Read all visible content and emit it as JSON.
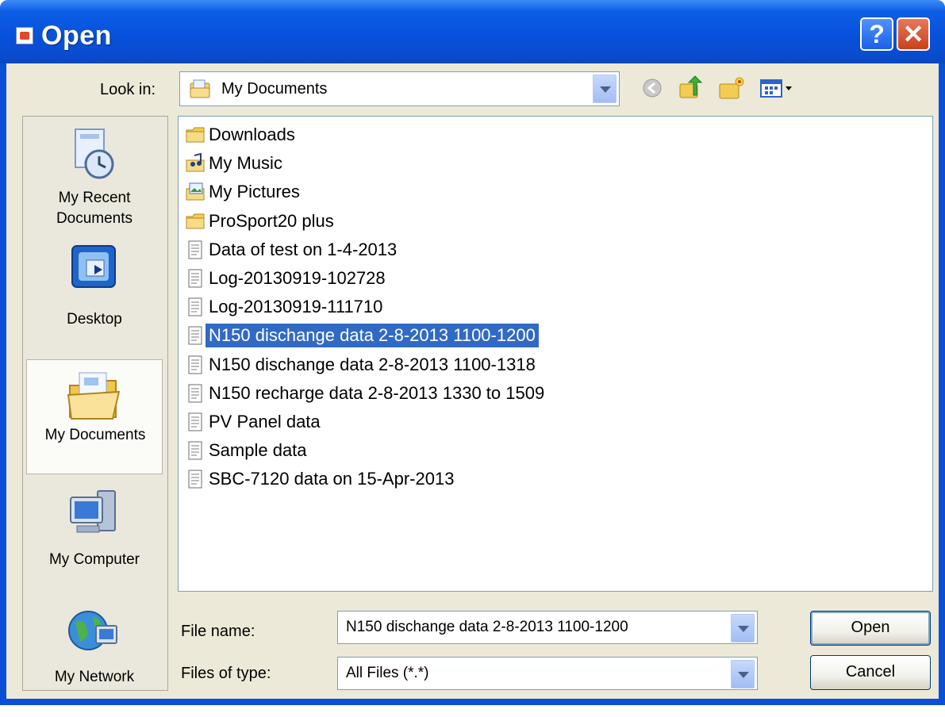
{
  "window": {
    "title": "Open",
    "help_glyph": "?",
    "close_glyph": "✕"
  },
  "toolbar": {
    "look_in_label": "Look in:",
    "look_in_value": "My Documents",
    "icons": [
      "back-icon",
      "up-one-level-icon",
      "create-new-folder-icon",
      "view-menu-icon"
    ]
  },
  "places": {
    "recent": "My Recent Documents",
    "desktop": "Desktop",
    "documents": "My Documents",
    "computer": "My Computer",
    "network": "My Network"
  },
  "files": [
    {
      "name": "Downloads",
      "icon": "folder-icon"
    },
    {
      "name": "My Music",
      "icon": "music-folder-icon"
    },
    {
      "name": "My Pictures",
      "icon": "pictures-folder-icon"
    },
    {
      "name": "ProSport20 plus",
      "icon": "folder-icon"
    },
    {
      "name": "Data of test on 1-4-2013",
      "icon": "text-file-icon"
    },
    {
      "name": "Log-20130919-102728",
      "icon": "text-file-icon"
    },
    {
      "name": "Log-20130919-111710",
      "icon": "text-file-icon"
    },
    {
      "name": "N150 dischange data 2-8-2013 1100-1200",
      "icon": "text-file-icon",
      "selected": true
    },
    {
      "name": "N150 dischange data 2-8-2013 1100-1318",
      "icon": "text-file-icon"
    },
    {
      "name": "N150 recharge data 2-8-2013 1330 to 1509",
      "icon": "text-file-icon"
    },
    {
      "name": "PV Panel data",
      "icon": "text-file-icon"
    },
    {
      "name": "Sample data",
      "icon": "text-file-icon"
    },
    {
      "name": "SBC-7120 data on 15-Apr-2013",
      "icon": "text-file-icon"
    }
  ],
  "footer": {
    "file_name_label": "File name:",
    "file_name_value": "N150 dischange data 2-8-2013 1100-1200",
    "file_type_label": "Files of type:",
    "file_type_value": "All Files (*.*)",
    "open_label": "Open",
    "cancel_label": "Cancel"
  },
  "colors": {
    "titlebar": "#0751dc",
    "dialog_bg": "#ece9d8",
    "selection": "#316ac5",
    "close": "#c8421c"
  }
}
